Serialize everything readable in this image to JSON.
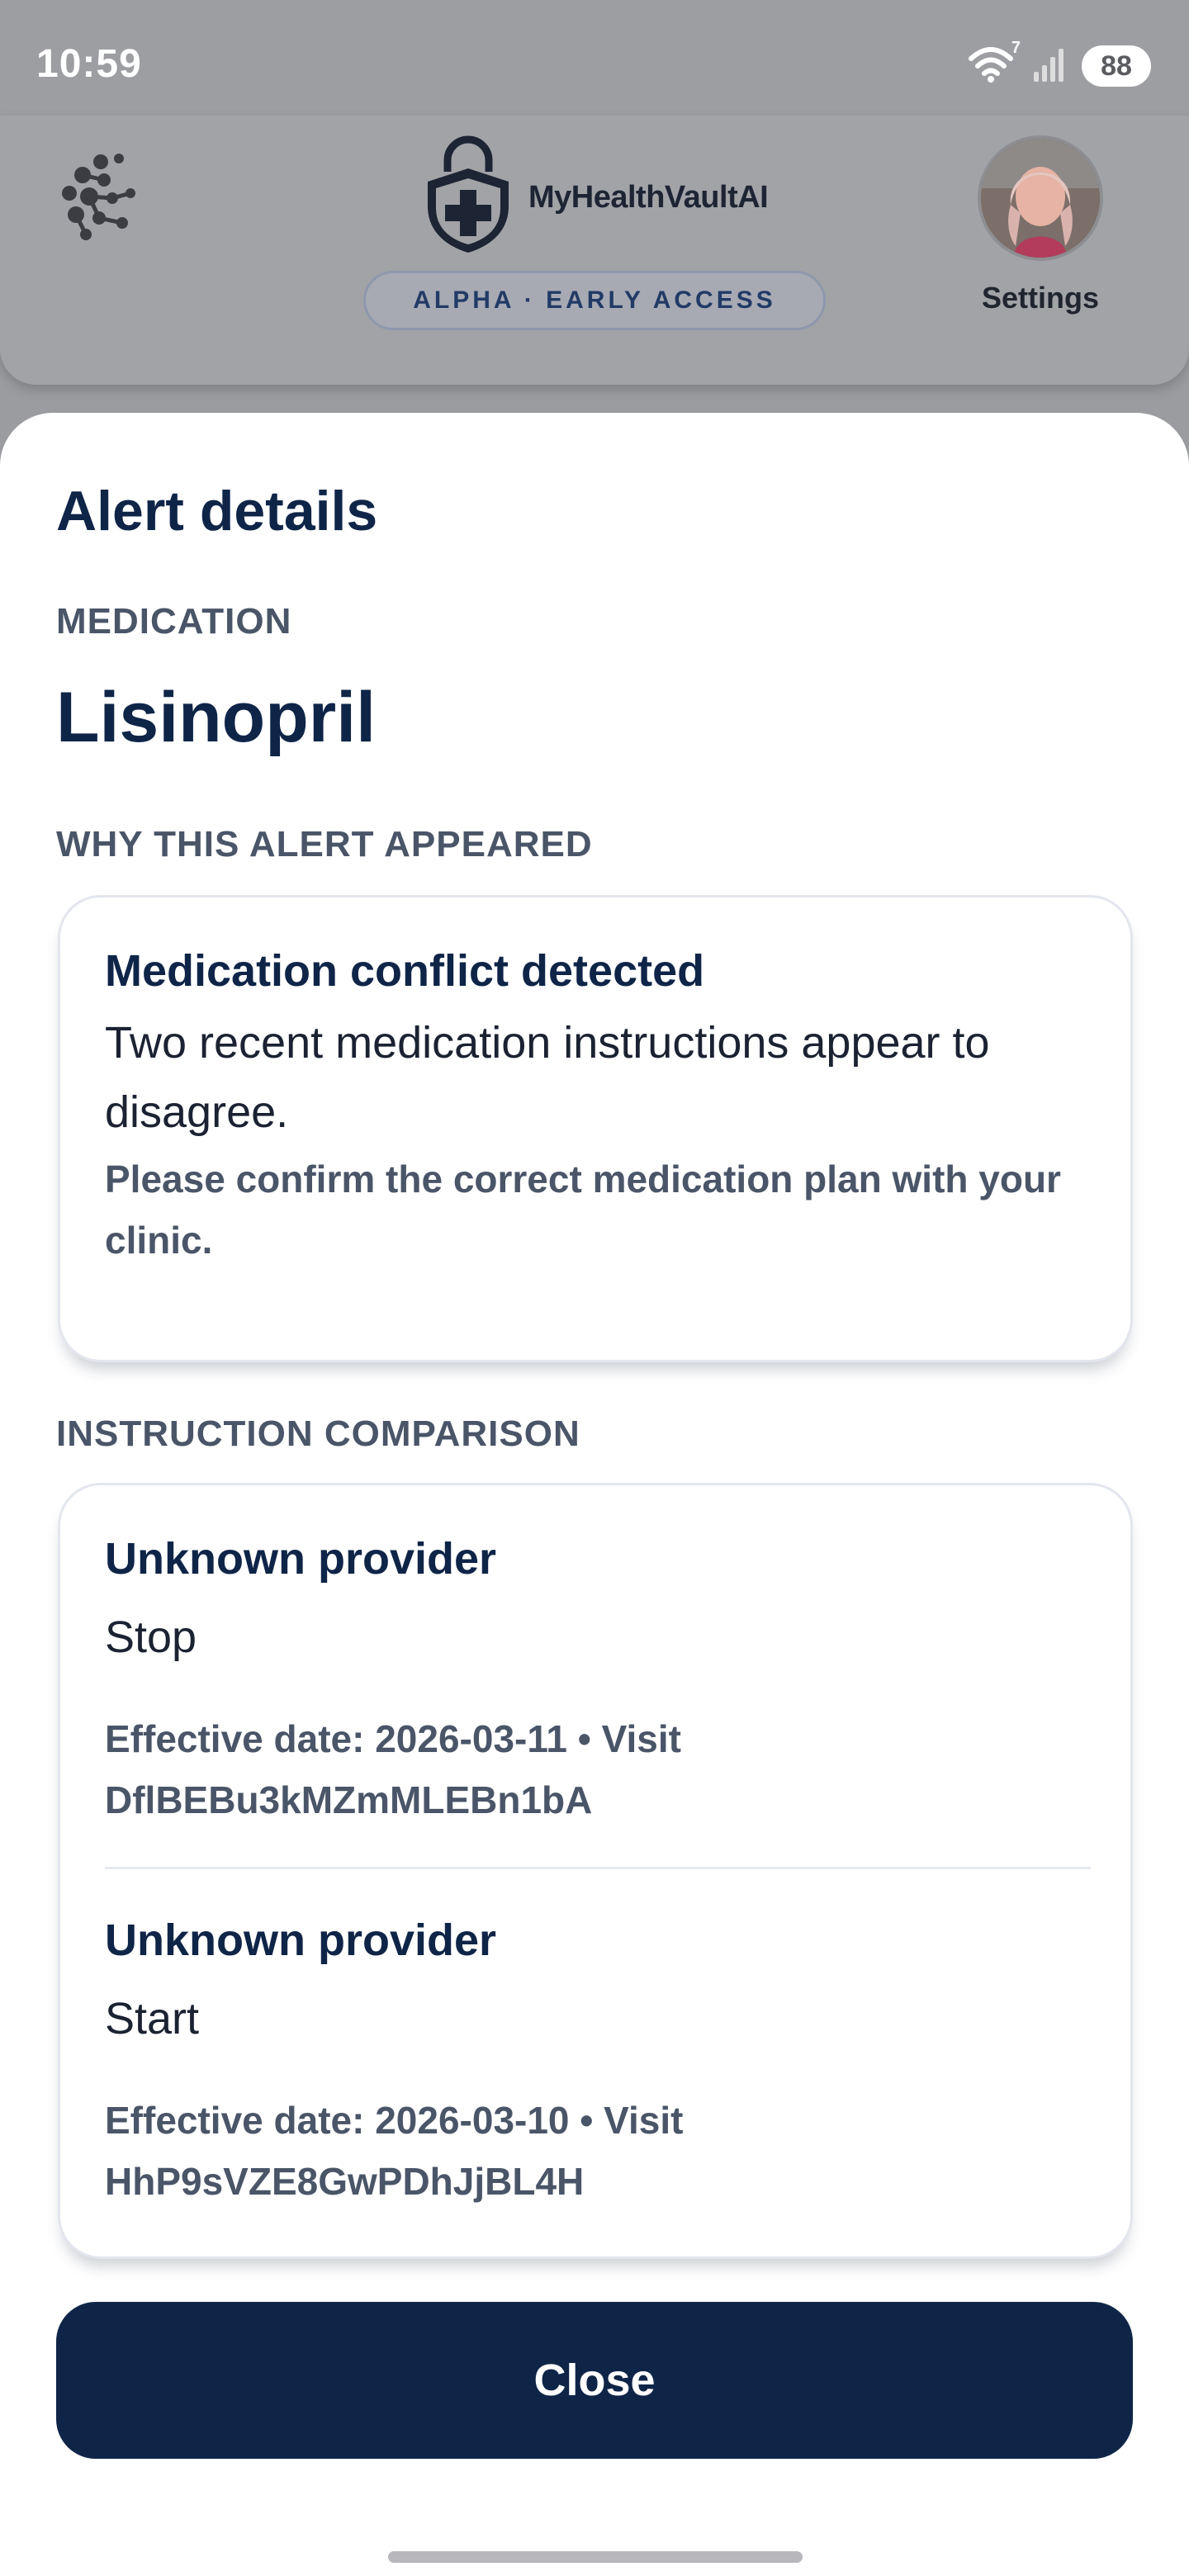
{
  "status_bar": {
    "time": "10:59",
    "battery": "88",
    "wifi_badge": "7",
    "icons": [
      "wifi-icon",
      "signal-icon",
      "battery-icon"
    ]
  },
  "header": {
    "app_name": "MyHealthVaultAI",
    "badge": "ALPHA · EARLY ACCESS",
    "settings_label": "Settings",
    "icons": [
      "brand-mark-icon",
      "shield-cross-logo",
      "avatar"
    ]
  },
  "sheet": {
    "title": "Alert details",
    "medication_label": "MEDICATION",
    "medication_name": "Lisinopril",
    "why_label": "WHY THIS ALERT APPEARED",
    "conflict": {
      "heading": "Medication conflict detected",
      "body": "Two recent medication instructions appear to disagree.",
      "note": "Please confirm the correct medication plan with your clinic."
    },
    "comparison_label": "INSTRUCTION COMPARISON",
    "instructions": [
      {
        "provider": "Unknown provider",
        "action": "Stop",
        "detail": "Effective date: 2026-03-11 • Visit DflBEBu3kMZmMLEBn1bA"
      },
      {
        "provider": "Unknown provider",
        "action": "Start",
        "detail": "Effective date: 2026-03-10 • Visit HhP9sVZE8GwPDhJjBL4H"
      }
    ],
    "close_label": "Close"
  },
  "colors": {
    "navy": "#0f2548",
    "muted_text": "#4a5568",
    "scrim": "#9d9ea2",
    "sheet_bg": "#ffffff"
  }
}
